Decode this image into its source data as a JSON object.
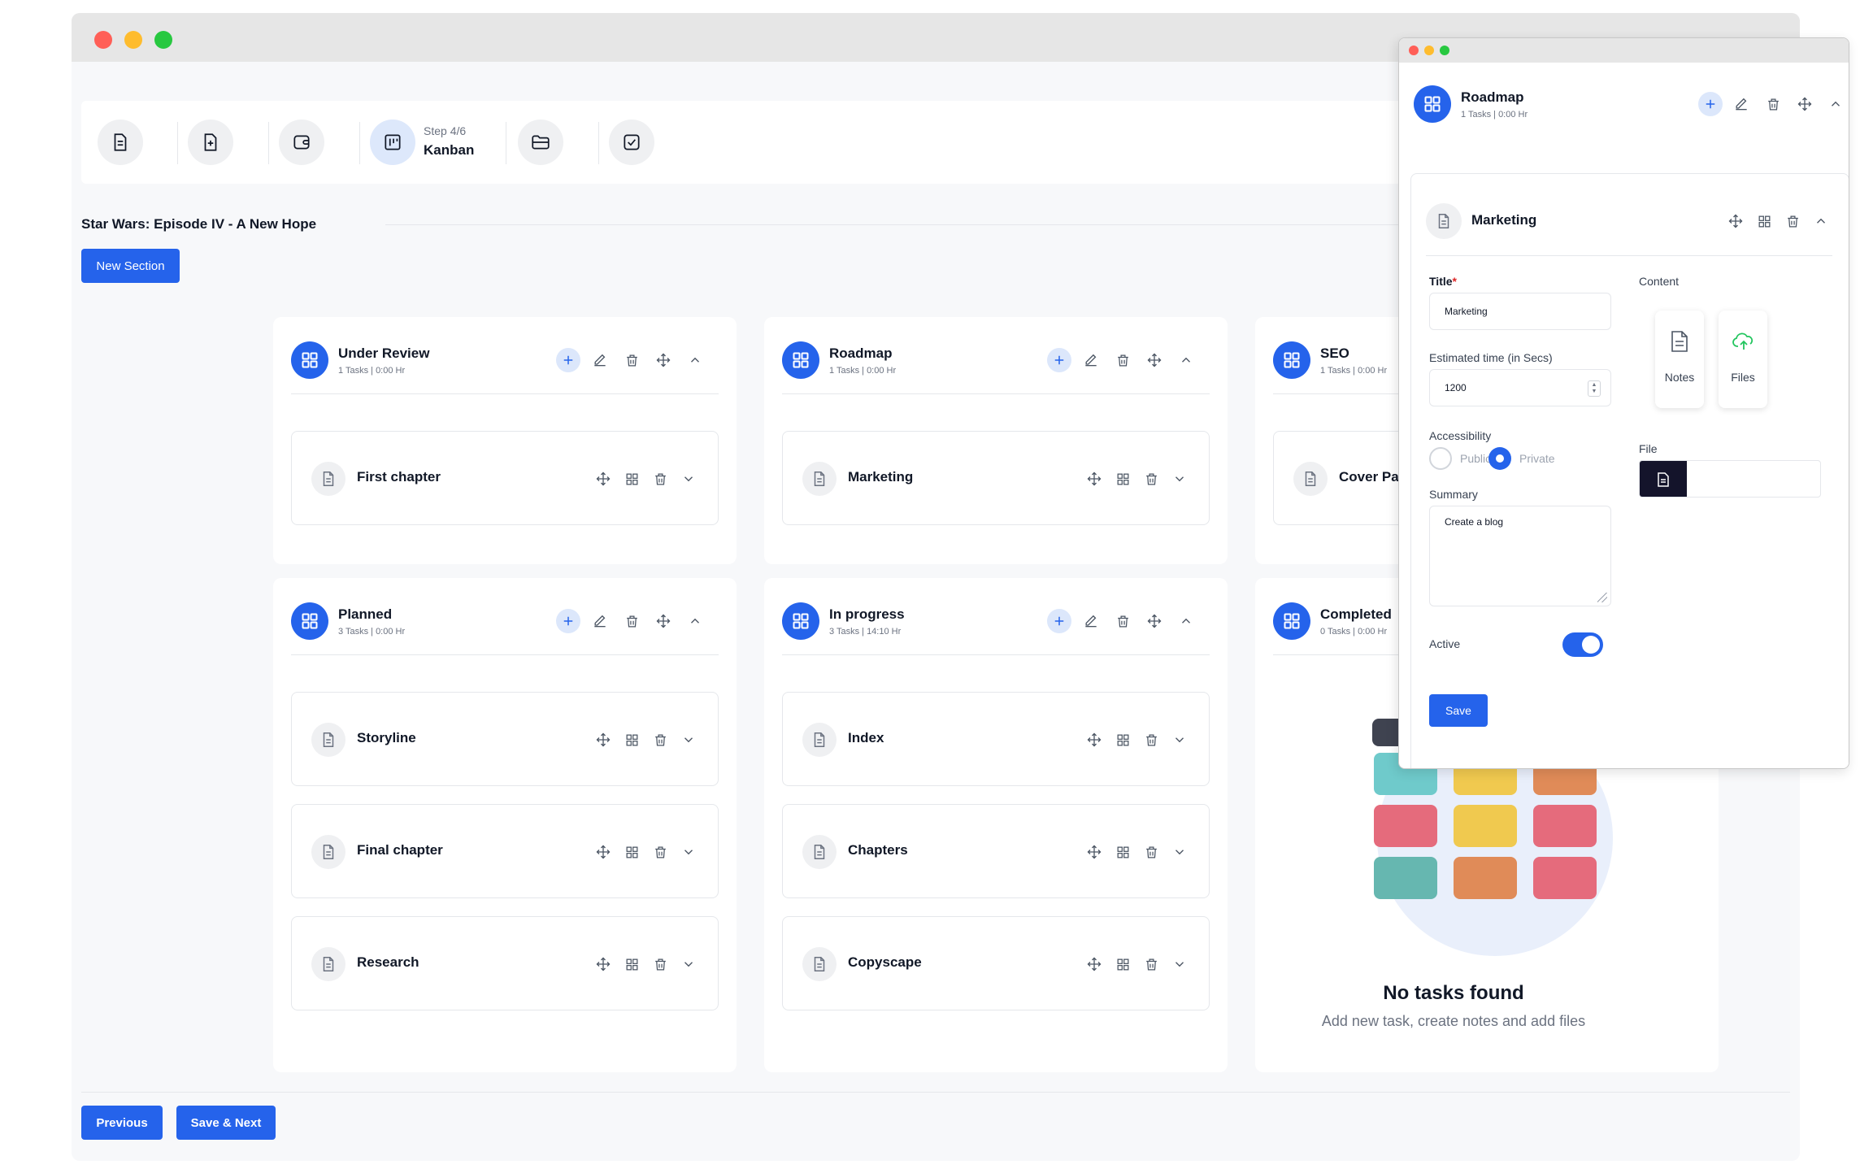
{
  "stepper": {
    "active_step": "Step 4/6",
    "active_label": "Kanban"
  },
  "project": {
    "title": "Star Wars: Episode IV - A New Hope",
    "new_section_label": "New Section"
  },
  "columns": [
    {
      "title": "Under Review",
      "subtitle": "1 Tasks | 0:00 Hr",
      "cards": [
        "First chapter"
      ]
    },
    {
      "title": "Roadmap",
      "subtitle": "1 Tasks | 0:00 Hr",
      "cards": [
        "Marketing"
      ]
    },
    {
      "title": "SEO",
      "subtitle": "1 Tasks | 0:00 Hr",
      "cards": [
        "Cover Pa"
      ]
    },
    {
      "title": "Planned",
      "subtitle": "3 Tasks | 0:00 Hr",
      "cards": [
        "Storyline",
        "Final chapter",
        "Research"
      ]
    },
    {
      "title": "In progress",
      "subtitle": "3 Tasks | 14:10 Hr",
      "cards": [
        "Index",
        "Chapters",
        "Copyscape"
      ]
    },
    {
      "title": "Completed",
      "subtitle": "0 Tasks | 0:00 Hr",
      "cards": []
    }
  ],
  "empty_state": {
    "title": "No tasks found",
    "message": "Add new task, create notes and add files"
  },
  "footer": {
    "previous_label": "Previous",
    "save_next_label": "Save & Next"
  },
  "panel": {
    "section_title": "Roadmap",
    "section_subtitle": "1 Tasks | 0:00 Hr",
    "task_title": "Marketing",
    "form": {
      "title_label": "Title",
      "required_mark": "*",
      "title_value": "Marketing",
      "time_label": "Estimated time (in Secs)",
      "time_value": "1200",
      "accessibility_label": "Accessibility",
      "public_label": "Public",
      "private_label": "Private",
      "selected_accessibility": "Private",
      "summary_label": "Summary",
      "summary_value": "Create a blog",
      "active_label": "Active",
      "active_on": true,
      "save_label": "Save"
    },
    "content": {
      "label": "Content",
      "notes_label": "Notes",
      "files_label": "Files",
      "file_label": "File"
    }
  },
  "colors": {
    "accent": "#2563eb",
    "accent_light": "#dce7fb",
    "files_icon": "#22c55e",
    "required": "#dc2626"
  }
}
